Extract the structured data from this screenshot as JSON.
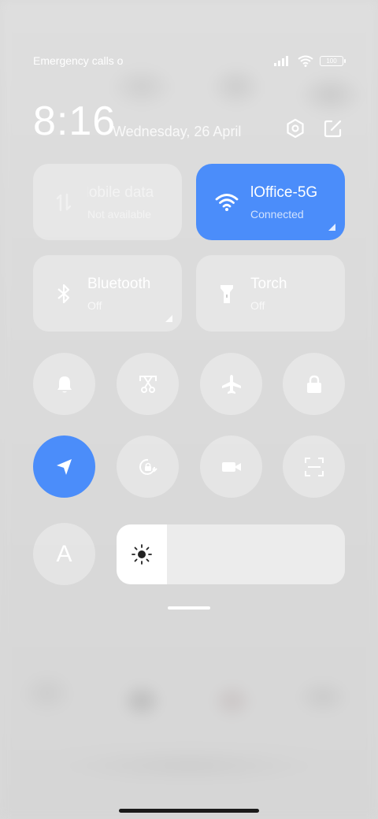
{
  "status": {
    "carrier_text": "Emergency calls o",
    "battery": "100"
  },
  "header": {
    "time": "8:16",
    "date": "Wednesday, 26 April"
  },
  "tiles": [
    {
      "label": "Mobile data",
      "sub": "Not available",
      "icon": "mobile-data-icon",
      "active": false
    },
    {
      "label": "lOffice-5G",
      "sub": "Connected",
      "icon": "wifi-icon",
      "active": true
    },
    {
      "label": "Bluetooth",
      "sub": "Off",
      "icon": "bluetooth-icon",
      "active": false
    },
    {
      "label": "Torch",
      "sub": "Off",
      "icon": "torch-icon",
      "active": false
    }
  ],
  "toggles_row1": [
    "bell-icon",
    "screenshot-icon",
    "airplane-icon",
    "lock-icon"
  ],
  "toggles_row2": [
    "location-icon",
    "rotation-lock-icon",
    "video-icon",
    "scan-icon"
  ],
  "font_button": "A",
  "brightness": {
    "level": 0.22
  },
  "colors": {
    "accent": "#4b8dfa"
  }
}
